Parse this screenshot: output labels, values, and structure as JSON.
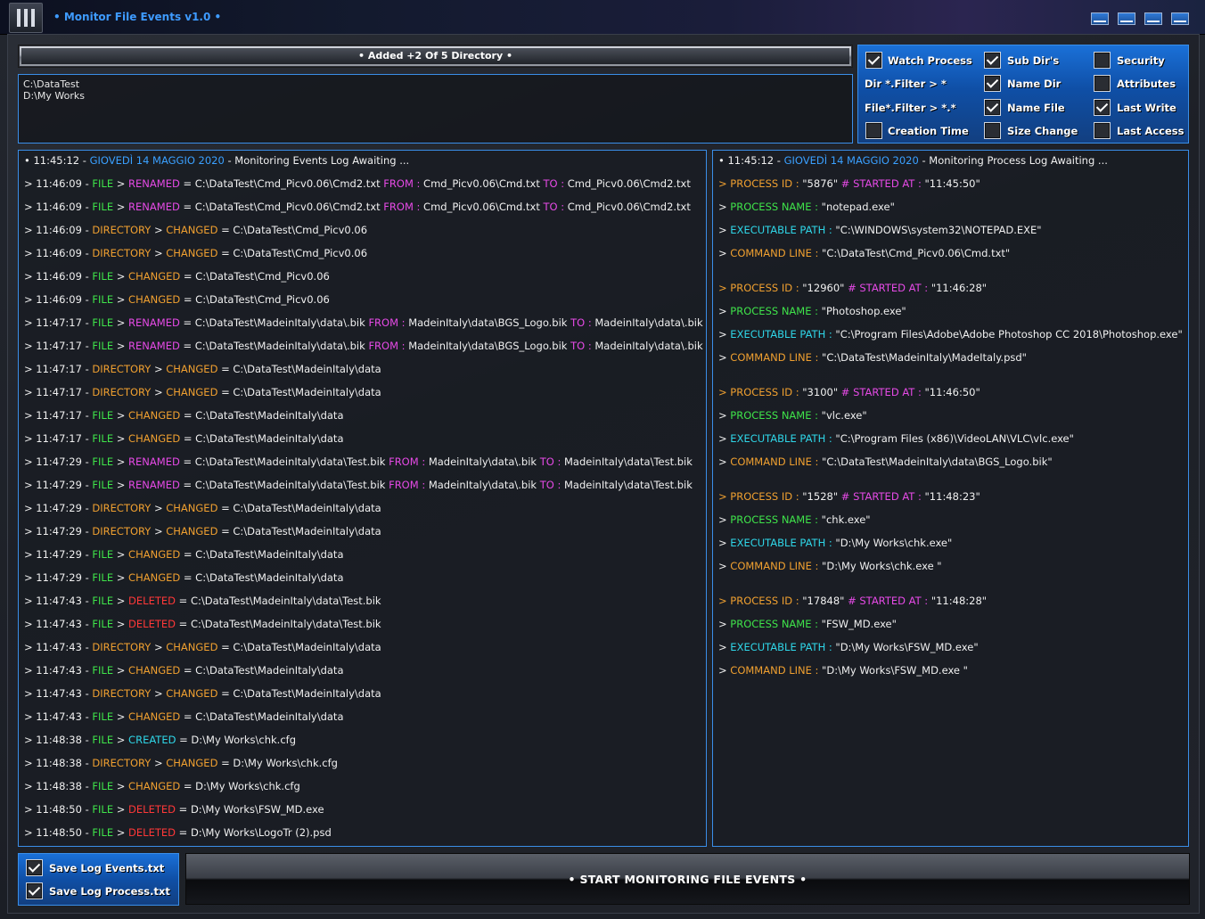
{
  "window": {
    "title": "• Monitor File Events v1.0 •"
  },
  "directories": {
    "header": "• Added +2 Of 5 Directory •",
    "items": [
      "C:\\DataTest",
      "D:\\My Works"
    ]
  },
  "options": {
    "watch_process": {
      "label": "Watch Process",
      "checked": true
    },
    "sub_dirs": {
      "label": "Sub Dir's",
      "checked": true
    },
    "security": {
      "label": "Security",
      "checked": false
    },
    "dir_filter": "Dir *.Filter > *",
    "name_dir": {
      "label": "Name Dir",
      "checked": true
    },
    "attributes": {
      "label": "Attributes",
      "checked": false
    },
    "file_filter": "File*.Filter > *.*",
    "name_file": {
      "label": "Name File",
      "checked": true
    },
    "last_write": {
      "label": "Last Write",
      "checked": true
    },
    "creation_time": {
      "label": "Creation Time",
      "checked": false
    },
    "size_change": {
      "label": "Size Change",
      "checked": false
    },
    "last_access": {
      "label": "Last Access",
      "checked": false
    }
  },
  "events_log": [
    [
      [
        "• 11:45:12 - ",
        "w"
      ],
      [
        "GIOVEDÌ 14 MAGGIO 2020",
        "bl"
      ],
      [
        " - Monitoring Events Log Awaiting ...",
        "w"
      ]
    ],
    [
      [
        "> 11:46:09 - ",
        "w"
      ],
      [
        "FILE",
        "gr"
      ],
      [
        " > ",
        "w"
      ],
      [
        "RENAMED",
        "mg"
      ],
      [
        " = C:\\DataTest\\Cmd_Picv0.06\\Cmd2.txt ",
        "w"
      ],
      [
        "FROM :",
        "mg"
      ],
      [
        " Cmd_Picv0.06\\Cmd.txt ",
        "w"
      ],
      [
        "TO :",
        "mg"
      ],
      [
        " Cmd_Picv0.06\\Cmd2.txt",
        "w"
      ]
    ],
    [
      [
        "> 11:46:09 - ",
        "w"
      ],
      [
        "FILE",
        "gr"
      ],
      [
        " > ",
        "w"
      ],
      [
        "RENAMED",
        "mg"
      ],
      [
        " = C:\\DataTest\\Cmd_Picv0.06\\Cmd2.txt ",
        "w"
      ],
      [
        "FROM :",
        "mg"
      ],
      [
        " Cmd_Picv0.06\\Cmd.txt ",
        "w"
      ],
      [
        "TO :",
        "mg"
      ],
      [
        " Cmd_Picv0.06\\Cmd2.txt",
        "w"
      ]
    ],
    [
      [
        "> 11:46:09 - ",
        "w"
      ],
      [
        "DIRECTORY",
        "or"
      ],
      [
        " > ",
        "w"
      ],
      [
        "CHANGED",
        "or"
      ],
      [
        " = C:\\DataTest\\Cmd_Picv0.06",
        "w"
      ]
    ],
    [
      [
        "> 11:46:09 - ",
        "w"
      ],
      [
        "DIRECTORY",
        "or"
      ],
      [
        " > ",
        "w"
      ],
      [
        "CHANGED",
        "or"
      ],
      [
        " = C:\\DataTest\\Cmd_Picv0.06",
        "w"
      ]
    ],
    [
      [
        "> 11:46:09 - ",
        "w"
      ],
      [
        "FILE",
        "gr"
      ],
      [
        " > ",
        "w"
      ],
      [
        "CHANGED",
        "or"
      ],
      [
        " = C:\\DataTest\\Cmd_Picv0.06",
        "w"
      ]
    ],
    [
      [
        "> 11:46:09 - ",
        "w"
      ],
      [
        "FILE",
        "gr"
      ],
      [
        " > ",
        "w"
      ],
      [
        "CHANGED",
        "or"
      ],
      [
        " = C:\\DataTest\\Cmd_Picv0.06",
        "w"
      ]
    ],
    [
      [
        "> 11:47:17 - ",
        "w"
      ],
      [
        "FILE",
        "gr"
      ],
      [
        " > ",
        "w"
      ],
      [
        "RENAMED",
        "mg"
      ],
      [
        " = C:\\DataTest\\MadeinItaly\\data\\.bik ",
        "w"
      ],
      [
        "FROM :",
        "mg"
      ],
      [
        " MadeinItaly\\data\\BGS_Logo.bik ",
        "w"
      ],
      [
        "TO :",
        "mg"
      ],
      [
        " MadeinItaly\\data\\.bik",
        "w"
      ]
    ],
    [
      [
        "> 11:47:17 - ",
        "w"
      ],
      [
        "FILE",
        "gr"
      ],
      [
        " > ",
        "w"
      ],
      [
        "RENAMED",
        "mg"
      ],
      [
        " = C:\\DataTest\\MadeinItaly\\data\\.bik ",
        "w"
      ],
      [
        "FROM :",
        "mg"
      ],
      [
        " MadeinItaly\\data\\BGS_Logo.bik ",
        "w"
      ],
      [
        "TO :",
        "mg"
      ],
      [
        " MadeinItaly\\data\\.bik",
        "w"
      ]
    ],
    [
      [
        "> 11:47:17 - ",
        "w"
      ],
      [
        "DIRECTORY",
        "or"
      ],
      [
        " > ",
        "w"
      ],
      [
        "CHANGED",
        "or"
      ],
      [
        " = C:\\DataTest\\MadeinItaly\\data",
        "w"
      ]
    ],
    [
      [
        "> 11:47:17 - ",
        "w"
      ],
      [
        "DIRECTORY",
        "or"
      ],
      [
        " > ",
        "w"
      ],
      [
        "CHANGED",
        "or"
      ],
      [
        " = C:\\DataTest\\MadeinItaly\\data",
        "w"
      ]
    ],
    [
      [
        "> 11:47:17 - ",
        "w"
      ],
      [
        "FILE",
        "gr"
      ],
      [
        " > ",
        "w"
      ],
      [
        "CHANGED",
        "or"
      ],
      [
        " = C:\\DataTest\\MadeinItaly\\data",
        "w"
      ]
    ],
    [
      [
        "> 11:47:17 - ",
        "w"
      ],
      [
        "FILE",
        "gr"
      ],
      [
        " > ",
        "w"
      ],
      [
        "CHANGED",
        "or"
      ],
      [
        " = C:\\DataTest\\MadeinItaly\\data",
        "w"
      ]
    ],
    [
      [
        "> 11:47:29 - ",
        "w"
      ],
      [
        "FILE",
        "gr"
      ],
      [
        " > ",
        "w"
      ],
      [
        "RENAMED",
        "mg"
      ],
      [
        " = C:\\DataTest\\MadeinItaly\\data\\Test.bik ",
        "w"
      ],
      [
        "FROM :",
        "mg"
      ],
      [
        " MadeinItaly\\data\\.bik ",
        "w"
      ],
      [
        "TO :",
        "mg"
      ],
      [
        " MadeinItaly\\data\\Test.bik",
        "w"
      ]
    ],
    [
      [
        "> 11:47:29 - ",
        "w"
      ],
      [
        "FILE",
        "gr"
      ],
      [
        " > ",
        "w"
      ],
      [
        "RENAMED",
        "mg"
      ],
      [
        " = C:\\DataTest\\MadeinItaly\\data\\Test.bik ",
        "w"
      ],
      [
        "FROM :",
        "mg"
      ],
      [
        " MadeinItaly\\data\\.bik ",
        "w"
      ],
      [
        "TO :",
        "mg"
      ],
      [
        " MadeinItaly\\data\\Test.bik",
        "w"
      ]
    ],
    [
      [
        "> 11:47:29 - ",
        "w"
      ],
      [
        "DIRECTORY",
        "or"
      ],
      [
        " > ",
        "w"
      ],
      [
        "CHANGED",
        "or"
      ],
      [
        " = C:\\DataTest\\MadeinItaly\\data",
        "w"
      ]
    ],
    [
      [
        "> 11:47:29 - ",
        "w"
      ],
      [
        "DIRECTORY",
        "or"
      ],
      [
        " > ",
        "w"
      ],
      [
        "CHANGED",
        "or"
      ],
      [
        " = C:\\DataTest\\MadeinItaly\\data",
        "w"
      ]
    ],
    [
      [
        "> 11:47:29 - ",
        "w"
      ],
      [
        "FILE",
        "gr"
      ],
      [
        " > ",
        "w"
      ],
      [
        "CHANGED",
        "or"
      ],
      [
        " = C:\\DataTest\\MadeinItaly\\data",
        "w"
      ]
    ],
    [
      [
        "> 11:47:29 - ",
        "w"
      ],
      [
        "FILE",
        "gr"
      ],
      [
        " > ",
        "w"
      ],
      [
        "CHANGED",
        "or"
      ],
      [
        " = C:\\DataTest\\MadeinItaly\\data",
        "w"
      ]
    ],
    [
      [
        "> 11:47:43 - ",
        "w"
      ],
      [
        "FILE",
        "gr"
      ],
      [
        " > ",
        "w"
      ],
      [
        "DELETED",
        "rd"
      ],
      [
        " = C:\\DataTest\\MadeinItaly\\data\\Test.bik",
        "w"
      ]
    ],
    [
      [
        "> 11:47:43 - ",
        "w"
      ],
      [
        "FILE",
        "gr"
      ],
      [
        " > ",
        "w"
      ],
      [
        "DELETED",
        "rd"
      ],
      [
        " = C:\\DataTest\\MadeinItaly\\data\\Test.bik",
        "w"
      ]
    ],
    [
      [
        "> 11:47:43 - ",
        "w"
      ],
      [
        "DIRECTORY",
        "or"
      ],
      [
        " > ",
        "w"
      ],
      [
        "CHANGED",
        "or"
      ],
      [
        " = C:\\DataTest\\MadeinItaly\\data",
        "w"
      ]
    ],
    [
      [
        "> 11:47:43 - ",
        "w"
      ],
      [
        "FILE",
        "gr"
      ],
      [
        " > ",
        "w"
      ],
      [
        "CHANGED",
        "or"
      ],
      [
        " = C:\\DataTest\\MadeinItaly\\data",
        "w"
      ]
    ],
    [
      [
        "> 11:47:43 - ",
        "w"
      ],
      [
        "DIRECTORY",
        "or"
      ],
      [
        " > ",
        "w"
      ],
      [
        "CHANGED",
        "or"
      ],
      [
        " = C:\\DataTest\\MadeinItaly\\data",
        "w"
      ]
    ],
    [
      [
        "> 11:47:43 - ",
        "w"
      ],
      [
        "FILE",
        "gr"
      ],
      [
        " > ",
        "w"
      ],
      [
        "CHANGED",
        "or"
      ],
      [
        " = C:\\DataTest\\MadeinItaly\\data",
        "w"
      ]
    ],
    [
      [
        "> 11:48:38 - ",
        "w"
      ],
      [
        "FILE",
        "gr"
      ],
      [
        " > ",
        "w"
      ],
      [
        "CREATED",
        "cy"
      ],
      [
        " = D:\\My Works\\chk.cfg",
        "w"
      ]
    ],
    [
      [
        "> 11:48:38 - ",
        "w"
      ],
      [
        "DIRECTORY",
        "or"
      ],
      [
        " > ",
        "w"
      ],
      [
        "CHANGED",
        "or"
      ],
      [
        " = D:\\My Works\\chk.cfg",
        "w"
      ]
    ],
    [
      [
        "> 11:48:38 - ",
        "w"
      ],
      [
        "FILE",
        "gr"
      ],
      [
        " > ",
        "w"
      ],
      [
        "CHANGED",
        "or"
      ],
      [
        " = D:\\My Works\\chk.cfg",
        "w"
      ]
    ],
    [
      [
        "> 11:48:50 - ",
        "w"
      ],
      [
        "FILE",
        "gr"
      ],
      [
        " > ",
        "w"
      ],
      [
        "DELETED",
        "rd"
      ],
      [
        " = D:\\My Works\\FSW_MD.exe",
        "w"
      ]
    ],
    [
      [
        "> 11:48:50 - ",
        "w"
      ],
      [
        "FILE",
        "gr"
      ],
      [
        " > ",
        "w"
      ],
      [
        "DELETED",
        "rd"
      ],
      [
        " = D:\\My Works\\LogoTr (2).psd",
        "w"
      ]
    ]
  ],
  "process_log": {
    "header": [
      [
        "• 11:45:12 - ",
        "w"
      ],
      [
        "GIOVEDÌ 14 MAGGIO 2020",
        "bl"
      ],
      [
        " - Monitoring Process Log Awaiting ...",
        "w"
      ]
    ],
    "processes": [
      {
        "id": "5876",
        "started": "11:45:50",
        "name": "notepad.exe",
        "exe": "C:\\WINDOWS\\system32\\NOTEPAD.EXE",
        "cmd": "C:\\DataTest\\Cmd_Picv0.06\\Cmd.txt"
      },
      {
        "id": "12960",
        "started": "11:46:28",
        "name": "Photoshop.exe",
        "exe": "C:\\Program Files\\Adobe\\Adobe Photoshop CC 2018\\Photoshop.exe",
        "cmd": "C:\\DataTest\\MadeinItaly\\MadeItaly.psd"
      },
      {
        "id": "3100",
        "started": "11:46:50",
        "name": "vlc.exe",
        "exe": "C:\\Program Files (x86)\\VideoLAN\\VLC\\vlc.exe",
        "cmd": "C:\\DataTest\\MadeinItaly\\data\\BGS_Logo.bik"
      },
      {
        "id": "1528",
        "started": "11:48:23",
        "name": "chk.exe",
        "exe": "D:\\My Works\\chk.exe",
        "cmd": "D:\\My Works\\chk.exe "
      },
      {
        "id": "17848",
        "started": "11:48:28",
        "name": "FSW_MD.exe",
        "exe": "D:\\My Works\\FSW_MD.exe",
        "cmd": "D:\\My Works\\FSW_MD.exe "
      }
    ],
    "labels": {
      "process_id": "> PROCESS ID :",
      "started_at": "# STARTED AT :",
      "process_name": "PROCESS NAME :",
      "executable_path": "EXECUTABLE PATH :",
      "command_line": "COMMAND LINE :"
    }
  },
  "save_options": {
    "save_events": {
      "label": "Save Log Events.txt",
      "checked": true
    },
    "save_process": {
      "label": "Save Log Process.txt",
      "checked": true
    }
  },
  "start_button": "• START MONITORING FILE EVENTS •",
  "colors": {
    "accent": "#3a8ee8",
    "date": "#3aa0ff",
    "file": "#3fe44a",
    "renamed": "#e64ae6",
    "changed": "#f0a030",
    "created": "#2fd6e8",
    "deleted": "#ff3838"
  }
}
